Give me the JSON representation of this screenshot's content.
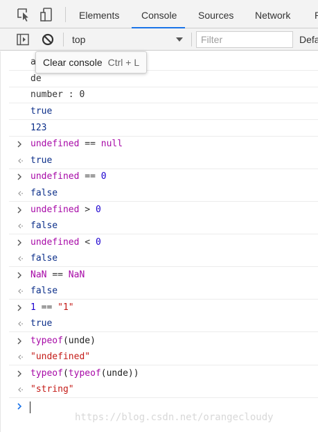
{
  "tabbar": {
    "inspect_icon": "element-picker-icon",
    "device_icon": "device-toolbar-icon",
    "tabs": [
      {
        "label": "Elements"
      },
      {
        "label": "Console"
      },
      {
        "label": "Sources"
      },
      {
        "label": "Network"
      },
      {
        "label": "P"
      }
    ],
    "active_tab": "Console",
    "accent_color": "#1a73e8"
  },
  "toolbar": {
    "sidebar_icon": "show-sidebar-icon",
    "clear_icon": "clear-console-icon",
    "context": "top",
    "filter_placeholder": "Filter",
    "levels_label": "Defa"
  },
  "tooltip": {
    "label": "Clear console",
    "shortcut": "Ctrl + L"
  },
  "console": {
    "entries": [
      {
        "kind": "log",
        "text": "a"
      },
      {
        "kind": "log",
        "text": "de"
      },
      {
        "kind": "log",
        "text": "number : 0"
      },
      {
        "kind": "log",
        "text": "true"
      },
      {
        "kind": "log",
        "text": "123"
      },
      {
        "kind": "input",
        "parts": [
          "undefined",
          "==",
          "null"
        ]
      },
      {
        "kind": "result",
        "text": "true"
      },
      {
        "kind": "input",
        "parts": [
          "undefined",
          "==",
          "0"
        ]
      },
      {
        "kind": "result",
        "text": "false"
      },
      {
        "kind": "input",
        "parts": [
          "undefined",
          ">",
          "0"
        ]
      },
      {
        "kind": "result",
        "text": "false"
      },
      {
        "kind": "input",
        "parts": [
          "undefined",
          "<",
          "0"
        ]
      },
      {
        "kind": "result",
        "text": "false"
      },
      {
        "kind": "input",
        "parts": [
          "NaN",
          "==",
          "NaN"
        ]
      },
      {
        "kind": "result",
        "text": "false"
      },
      {
        "kind": "input",
        "parts": [
          "1",
          "==",
          "\"1\""
        ]
      },
      {
        "kind": "result",
        "text": "true"
      },
      {
        "kind": "input",
        "parts": [
          "typeof",
          "(unde)"
        ]
      },
      {
        "kind": "result",
        "text": "\"undefined\""
      },
      {
        "kind": "input",
        "parts": [
          "typeof",
          "(",
          "typeof",
          "(unde))"
        ]
      },
      {
        "kind": "result",
        "text": "\"string\""
      }
    ],
    "prompt_icon": "prompt-chevron-icon"
  },
  "watermark": "https://blog.csdn.net/orangecloudy"
}
